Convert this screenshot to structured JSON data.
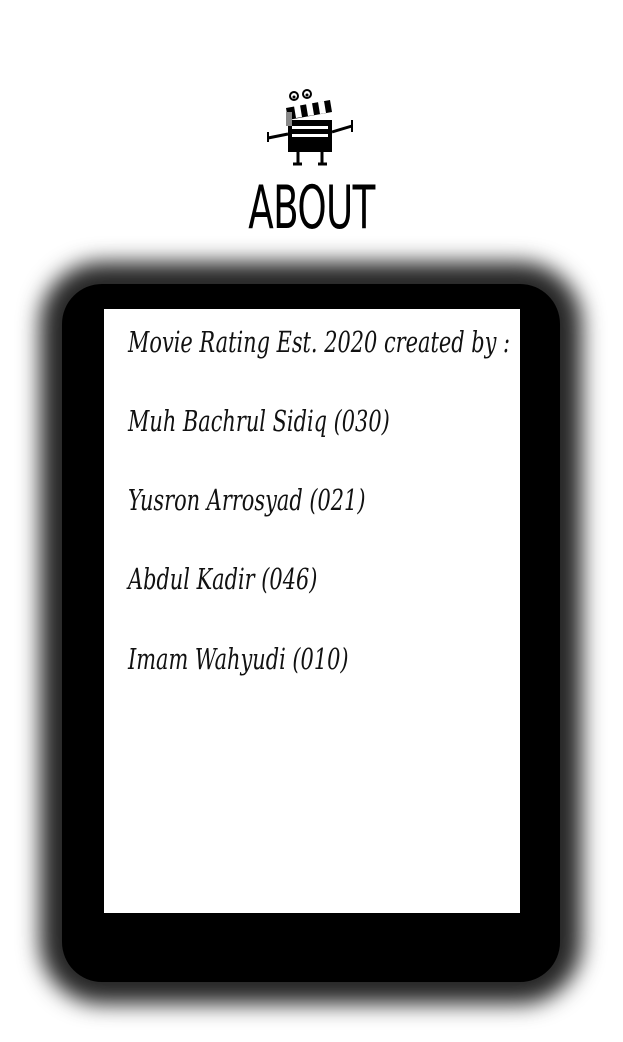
{
  "header": {
    "logo_icon": "clapperboard-mascot-icon",
    "title": "ABOUT"
  },
  "about_card": {
    "lines": [
      "Movie Rating Est. 2020 created by :",
      "Muh Bachrul Sidiq (030)",
      "Yusron Arrosyad (021)",
      "Abdul Kadir (046)",
      "Imam Wahyudi (010)"
    ]
  },
  "colors": {
    "background": "#ffffff",
    "frame": "#000000",
    "panel": "#ffffff",
    "text": "#111111"
  }
}
